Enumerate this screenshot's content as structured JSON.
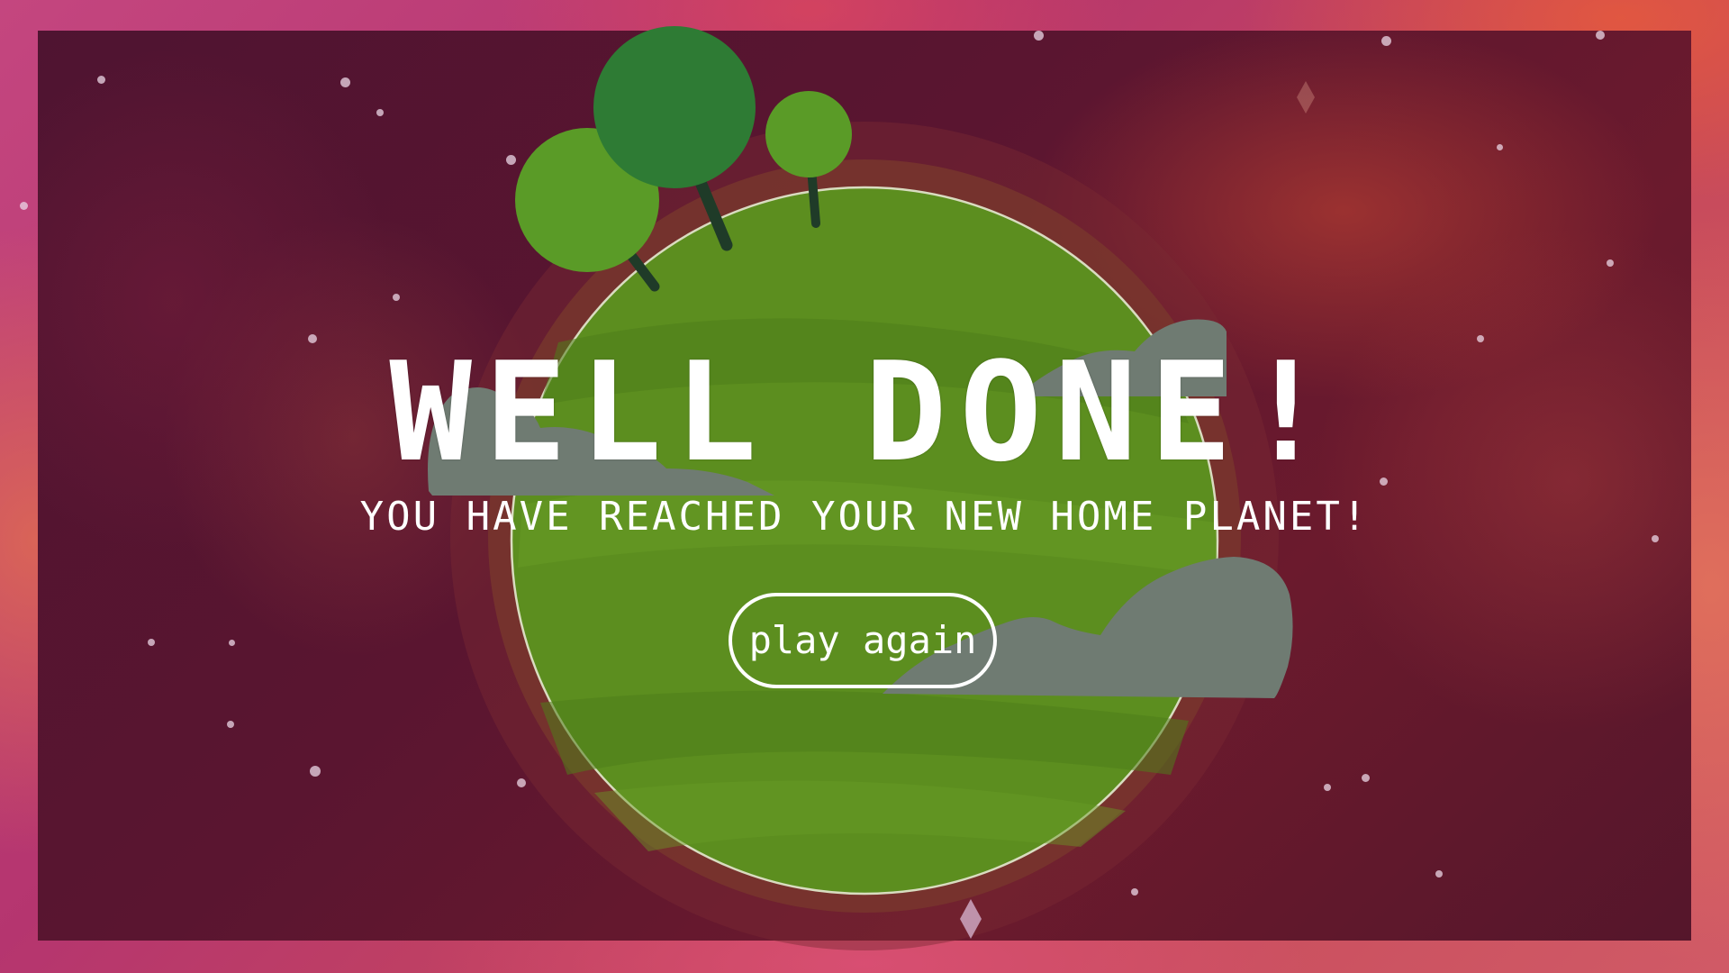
{
  "screen": {
    "title": "WELL DONE!",
    "message": "YOU HAVE REACHED YOUR NEW HOME PLANET!",
    "play_again_label": "play again"
  },
  "colors": {
    "background_outer": "#c4467f",
    "overlay": "#55162b",
    "planet_green": "#5c8e1f",
    "planet_rim": "#7a3a2c",
    "tree_dark": "#2e7b34",
    "tree_light": "#5a9b27",
    "cloud_gray": "#6f7b72",
    "text": "#ffffff"
  }
}
